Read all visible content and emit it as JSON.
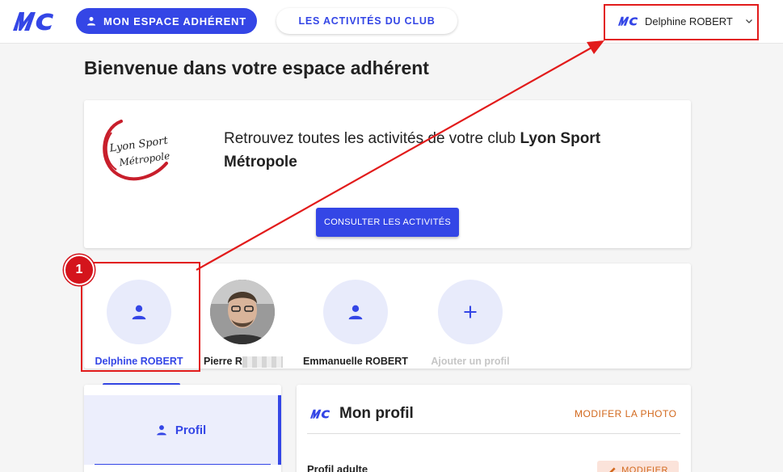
{
  "header": {
    "nav_espace": "MON ESPACE ADHÉRENT",
    "nav_activites": "LES ACTIVITÉS DU CLUB",
    "user_name": "Delphine ROBERT"
  },
  "main": {
    "title": "Bienvenue dans votre espace adhérent",
    "club": {
      "intro": "Retrouvez toutes les activités de votre club ",
      "name": "Lyon Sport Métropole",
      "logo_line1": "Lyon Sport",
      "logo_line2": "Métropole",
      "consult_button": "CONSULTER LES ACTIVITÉS"
    },
    "profiles": [
      {
        "name": "Delphine ROBERT",
        "active": true
      },
      {
        "name": "Pierre R"
      },
      {
        "name": "Emmanuelle ROBERT"
      },
      {
        "name": "Ajouter un profil"
      }
    ],
    "annotation_number": "1"
  },
  "side_menu": {
    "items": [
      {
        "label": "Profil"
      }
    ]
  },
  "profile_panel": {
    "title": "Mon profil",
    "photo_link": "MODIFER LA PHOTO",
    "section": "Profil adulte",
    "edit_button": "MODIFIER"
  },
  "colors": {
    "primary": "#3446e6",
    "accent_orange": "#d2691e",
    "annotation_red": "#e21b1b"
  }
}
